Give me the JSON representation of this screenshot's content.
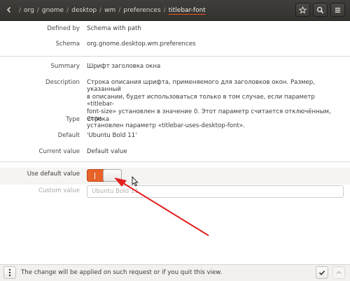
{
  "header": {
    "path": [
      "org",
      "gnome",
      "desktop",
      "wm",
      "preferences",
      "titlebar-font"
    ],
    "separator": "/"
  },
  "fields": {
    "defined_by": {
      "label": "Defined by",
      "value": "Schema with path"
    },
    "schema": {
      "label": "Schema",
      "value": "org.gnome.desktop.wm.preferences"
    },
    "summary": {
      "label": "Summary",
      "value": "Шрифт заголовка окна"
    },
    "description": {
      "label": "Description",
      "lines": [
        "Строка описания шрифта, применяемого для заголовков окон. Размер, указанный",
        "в описании, будет использоваться только в том случае, если параметр «titlebar-",
        "font-size» установлен в значение 0. Этот параметр считается отключённым, если",
        "установлен параметр «titlebar-uses-desktop-font»."
      ]
    },
    "type": {
      "label": "Type",
      "value": "Строка"
    },
    "default": {
      "label": "Default",
      "value": "'Ubuntu Bold 11'"
    },
    "current": {
      "label": "Current value",
      "value": "Default value"
    },
    "use_default": {
      "label": "Use default value",
      "switch_on_symbol": "I",
      "enabled": true
    },
    "custom": {
      "label": "Custom value",
      "value": "Ubuntu Bold 11"
    }
  },
  "bottombar": {
    "status": "The change will be applied on such request or if you quit this view."
  },
  "colors": {
    "accent": "#e95420",
    "switch": "#e8622a",
    "annotation_arrow": "#e22020"
  },
  "icons": {
    "back": "chevron-left-icon",
    "star": "star-icon",
    "search": "search-icon",
    "menu": "hamburger-menu-icon",
    "more": "vertical-dots-icon",
    "apply": "check-icon",
    "reset": "chevron-up-icon"
  }
}
